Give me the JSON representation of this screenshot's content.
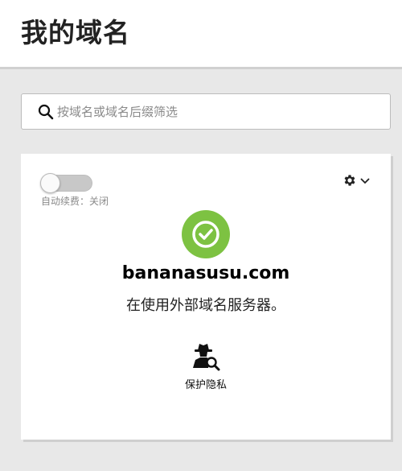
{
  "header": {
    "title": "我的域名"
  },
  "search": {
    "placeholder": "按域名或域名后缀筛选",
    "value": ""
  },
  "domain_card": {
    "auto_renew": {
      "label": "自动续费：关闭",
      "enabled": false
    },
    "settings_icon": "gear-icon",
    "status_icon": "check-circle-icon",
    "status_color": "#7dc242",
    "domain": "bananasusu.com",
    "status_text": "在使用外部域名服务器。",
    "privacy": {
      "label": "保护隐私",
      "icon": "privacy-spy-icon"
    }
  }
}
